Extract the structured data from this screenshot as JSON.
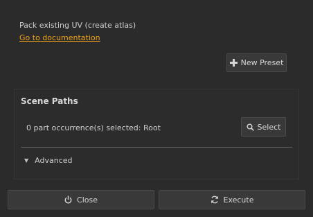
{
  "description": "Pack existing UV (create atlas)",
  "doc_link": "Go to documentation",
  "new_preset_label": "New Preset",
  "scene_paths": {
    "title": "Scene Paths",
    "selection_text": "0 part occurrence(s) selected: Root",
    "select_label": "Select"
  },
  "advanced_label": "Advanced",
  "footer": {
    "close_label": "Close",
    "execute_label": "Execute"
  },
  "icons": {
    "new_preset": "plus-icon",
    "select": "search-icon",
    "advanced": "caret-down-icon",
    "close": "power-icon",
    "execute": "refresh-icon"
  },
  "colors": {
    "background": "#2b2b2b",
    "link": "#f0a21b",
    "button": "#393939"
  }
}
